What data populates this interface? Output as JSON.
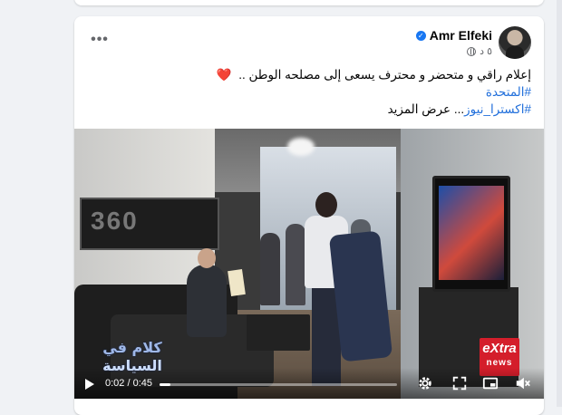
{
  "post": {
    "author": "Amr Elfeki",
    "verified": true,
    "time": "٥ د",
    "text_line1": "إعلام راقي و متحضر و محترف يسعى إلى مصلحه الوطن ..",
    "heart": "❤️",
    "hashtag1": "#المتحدة",
    "hashtag2": "#اكسترا_نيوز",
    "ellipsis": "...",
    "see_more": "عرض المزيد",
    "more_menu": "•••"
  },
  "video": {
    "current_time": "0:02",
    "duration": "0:45",
    "time_label": "0:02 / 0:45",
    "progress_fraction": 0.044,
    "watermark_left_line1": "كلام في",
    "watermark_left_line2": "السياسة",
    "watermark_right_line1": "eXtra",
    "watermark_right_line2": "news",
    "wall_sign": "360"
  },
  "colors": {
    "link": "#216fdb",
    "verified": "#1877f2",
    "extra_news_red": "#d41e2b"
  }
}
